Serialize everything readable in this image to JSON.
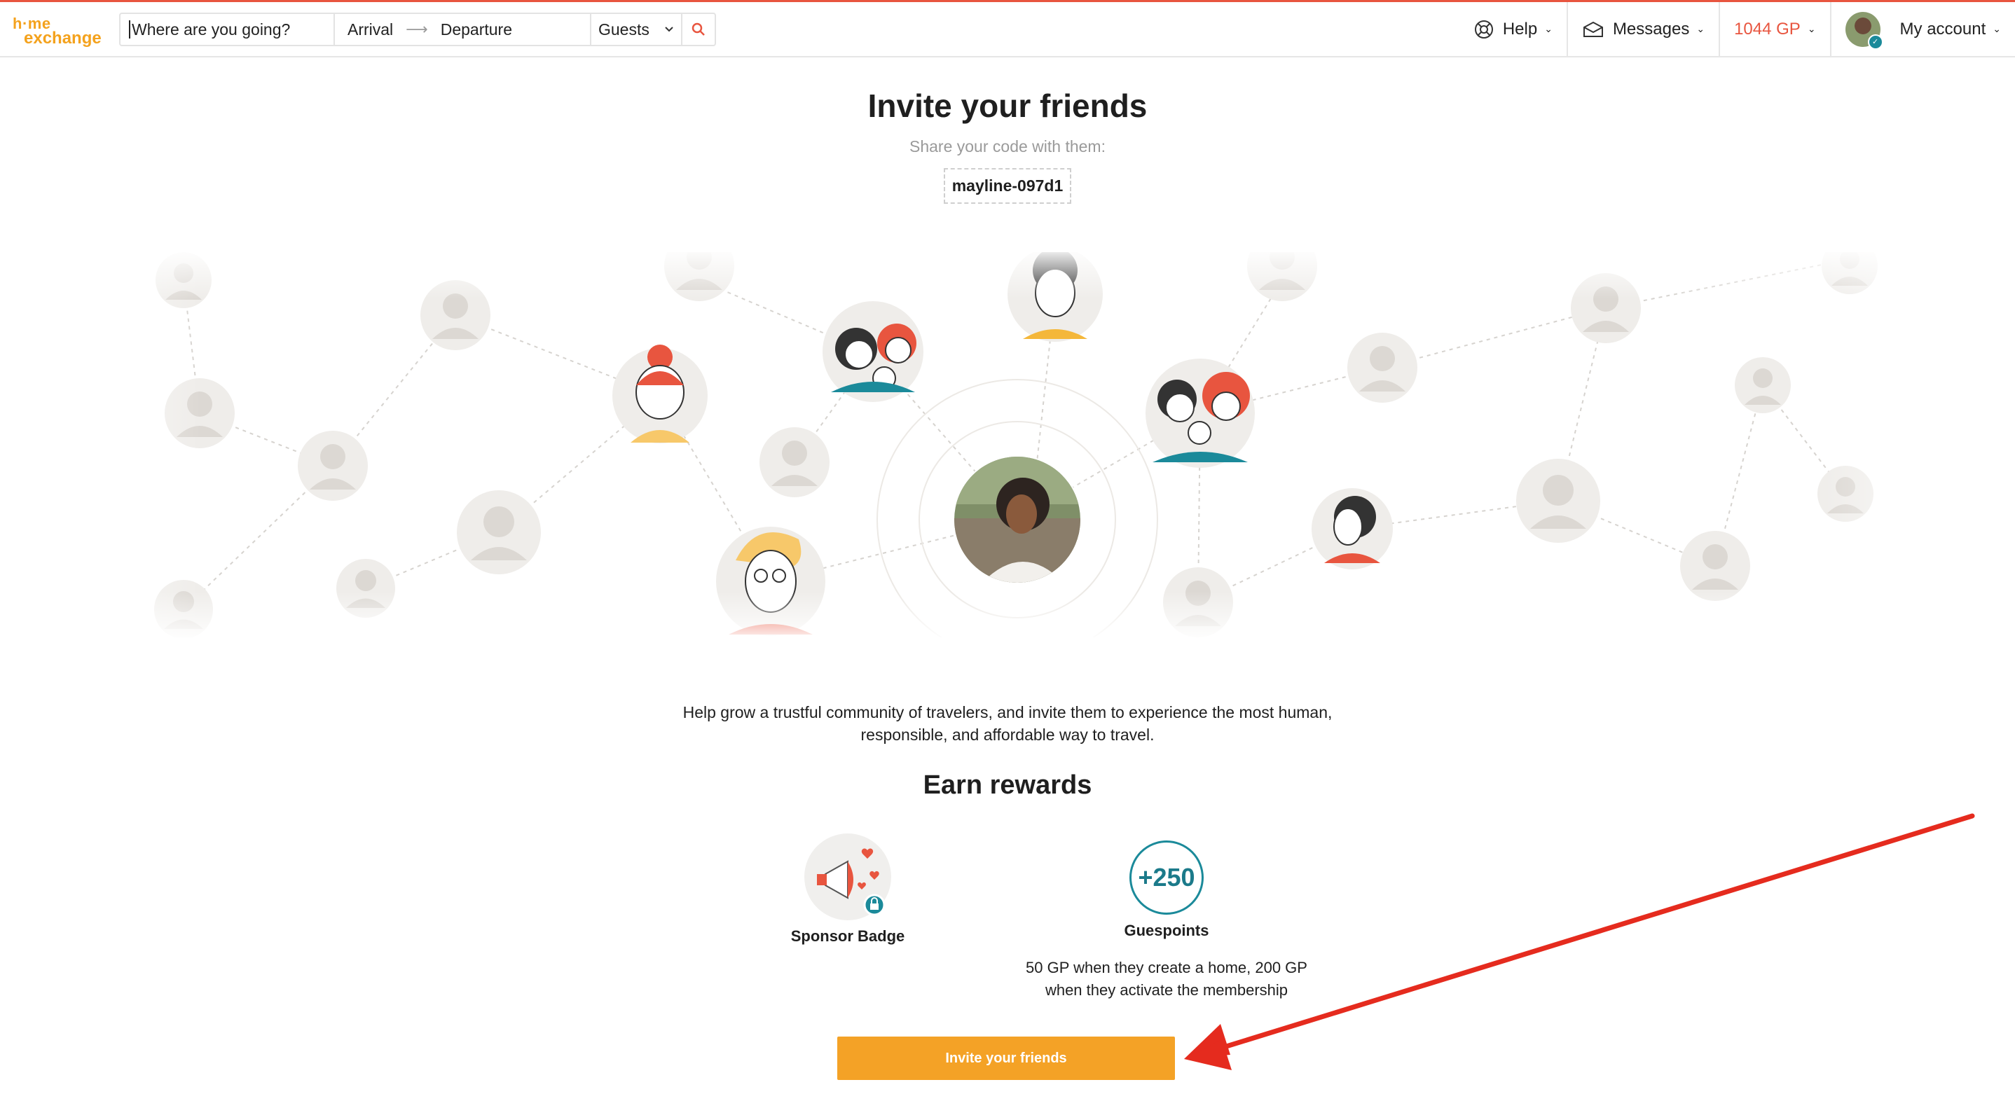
{
  "header": {
    "logo_line1": "h·me",
    "logo_line2": "exchange",
    "search": {
      "where_placeholder": "Where are you going?",
      "arrival": "Arrival",
      "arrow": "⟶",
      "departure": "Departure",
      "guests": "Guests"
    },
    "help_label": "Help",
    "messages_label": "Messages",
    "gp_value": "1044",
    "gp_unit": "GP",
    "account_label": "My account"
  },
  "main": {
    "title": "Invite your friends",
    "share_text": "Share your code with them:",
    "code": "mayline-097d1",
    "description": "Help grow a trustful community of travelers, and invite them to experience the most human, responsible, and affordable way to travel.",
    "earn_title": "Earn rewards",
    "rewards": [
      {
        "label": "Sponsor Badge",
        "sub": ""
      },
      {
        "badge_text": "+250",
        "label": "Guespoints",
        "sub": "50 GP when they create a home, 200 GP when they activate the membership"
      }
    ],
    "cta_label": "Invite your friends"
  },
  "colors": {
    "brand_orange": "#f4a226",
    "accent_red": "#e8553f",
    "teal": "#1b8a9a"
  }
}
